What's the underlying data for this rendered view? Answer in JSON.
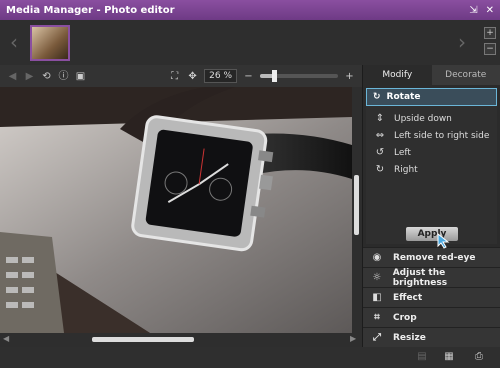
{
  "window": {
    "title": "Media Manager - Photo editor"
  },
  "filmstrip": {
    "prev_icon": "chevron-left-icon",
    "next_icon": "chevron-right-icon",
    "add_label": "+",
    "remove_label": "−"
  },
  "toolbar": {
    "zoom_value": "26 %",
    "zoom_minus": "−",
    "zoom_plus": "+",
    "zoom_level": 0.18
  },
  "panel": {
    "tabs": [
      {
        "label": "Modify"
      },
      {
        "label": "Decorate"
      }
    ],
    "rotate": {
      "title": "Rotate",
      "options": [
        {
          "label": "Upside down",
          "icon": "flip-vertical-icon"
        },
        {
          "label": "Left side to right side",
          "icon": "flip-horizontal-icon"
        },
        {
          "label": "Left",
          "icon": "rotate-left-icon"
        },
        {
          "label": "Right",
          "icon": "rotate-right-icon"
        }
      ],
      "apply_label": "Apply"
    },
    "actions": [
      {
        "label": "Remove red-eye",
        "icon": "eye-icon"
      },
      {
        "label": "Adjust the brightness",
        "icon": "brightness-icon"
      },
      {
        "label": "Effect",
        "icon": "effect-icon"
      },
      {
        "label": "Crop",
        "icon": "crop-icon"
      },
      {
        "label": "Resize",
        "icon": "resize-icon"
      }
    ]
  },
  "colors": {
    "accent": "#8a4fa0",
    "highlight": "#6bb6d8"
  }
}
